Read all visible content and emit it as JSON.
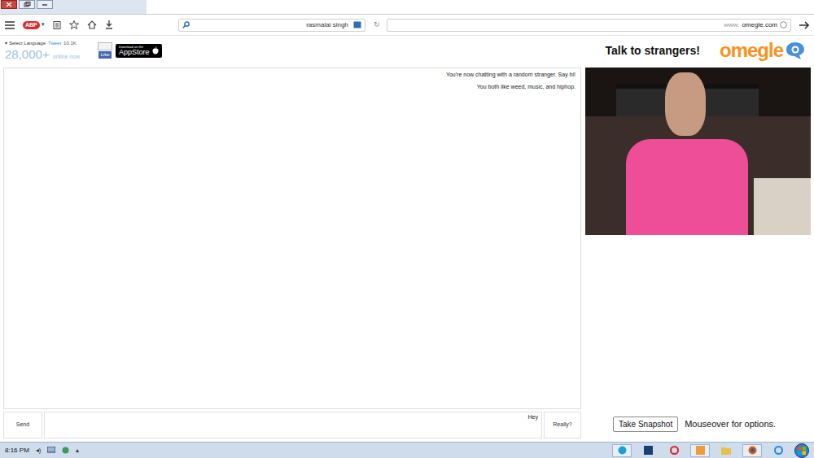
{
  "browser": {
    "url_prefix": "www.",
    "url": "omegle.com",
    "search": "rasmalai singh",
    "badge": "ABP"
  },
  "header": {
    "logo": "omegle",
    "tagline": "Talk to strangers!",
    "online_count": "28,000+",
    "online_label": "online now",
    "language": "Select Language",
    "tweet": "Tweet",
    "like": "Like",
    "like_count": "10.1K",
    "app_store_small": "Download on the",
    "app_store": "AppStore"
  },
  "chat": {
    "messages": [
      "You're now chatting with a random stranger. Say hi!",
      "You both like weed, music, and hiphop."
    ],
    "input": "Hey",
    "really": "Really?",
    "send": "Send"
  },
  "video_controls": {
    "hint": "Mouseover for options.",
    "snapshot": "Take Snapshot"
  },
  "taskbar": {
    "time": "8:16 PM"
  }
}
